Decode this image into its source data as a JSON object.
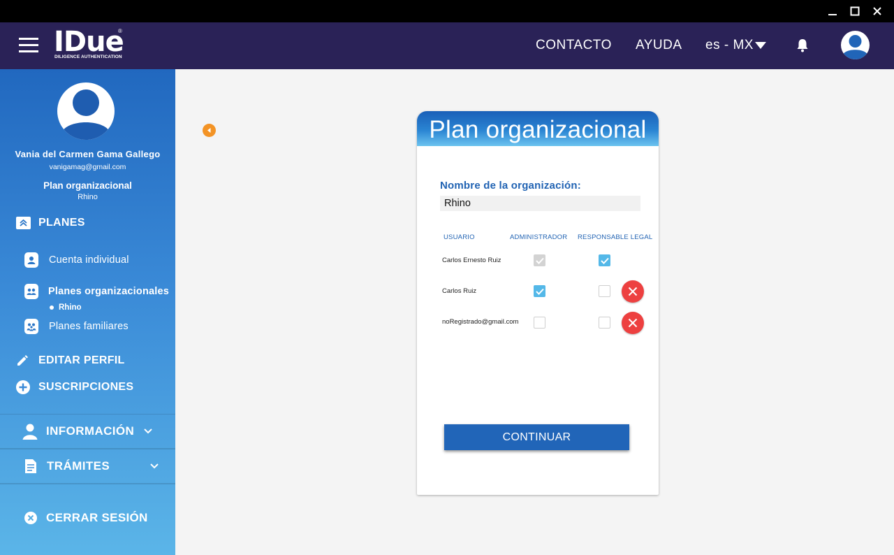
{
  "header": {
    "logo_text": "IDue",
    "logo_registered": "®",
    "logo_subtitle": "DILIGENCE AUTHENTICATION",
    "nav": {
      "contact": "CONTACTO",
      "help": "AYUDA",
      "language": "es - MX"
    }
  },
  "sidebar": {
    "user_name": "Vania del Carmen Gama Gallego",
    "user_email": "vanigamag@gmail.com",
    "plan_title": "Plan organizacional",
    "plan_name": "Rhino",
    "plans_label": "PLANES",
    "plan_items": [
      {
        "label": "Cuenta individual"
      },
      {
        "label": "Planes organizacionales",
        "sub": "Rhino"
      },
      {
        "label": "Planes familiares"
      }
    ],
    "edit_profile": "EDITAR PERFIL",
    "subscriptions": "SUSCRIPCIONES",
    "information": "INFORMACIÓN",
    "procedures": "TRÁMITES",
    "logout": "CERRAR SESIÓN"
  },
  "card": {
    "title": "Plan organizacional",
    "org_label": "Nombre de la organización:",
    "org_value": "Rhino",
    "columns": [
      "USUARIO",
      "ADMINISTRADOR",
      "RESPONSABLE LEGAL"
    ],
    "rows": [
      {
        "user": "Carlos Ernesto Ruiz",
        "admin": "checked-disabled",
        "legal": "checked",
        "deletable": false
      },
      {
        "user": "Carlos Ruiz",
        "admin": "checked",
        "legal": "unchecked",
        "deletable": true
      },
      {
        "user": "noRegistrado@gmail.com",
        "admin": "unchecked",
        "legal": "unchecked",
        "deletable": true
      }
    ],
    "continue_label": "CONTINUAR"
  },
  "colors": {
    "header_bg": "#2a2257",
    "sidebar_top": "#2168bf",
    "sidebar_bottom": "#5bb5e8",
    "accent_blue": "#2163b3",
    "checkbox_on": "#54b8e8",
    "delete_red": "#ed4040",
    "collapse_orange": "#f39325"
  }
}
